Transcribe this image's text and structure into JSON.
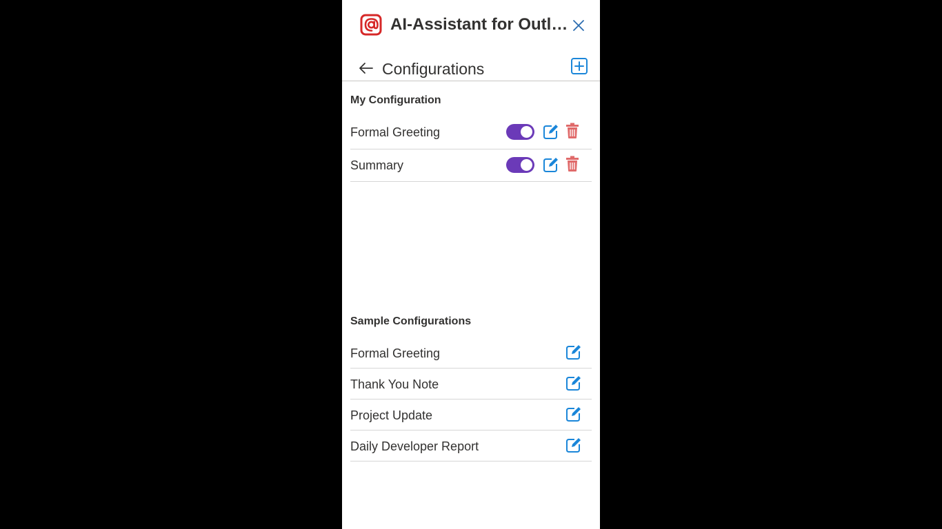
{
  "app": {
    "title": "AI-Assistant for Outlook",
    "logo_icon": "at-sign-logo-icon",
    "close_icon": "close-icon"
  },
  "nav": {
    "back_icon": "arrow-left-icon",
    "title": "Configurations",
    "add_icon": "plus-square-icon"
  },
  "my_configuration": {
    "heading": "My Configuration",
    "items": [
      {
        "label": "Formal Greeting",
        "enabled": true
      },
      {
        "label": "Summary",
        "enabled": true
      }
    ]
  },
  "sample_configurations": {
    "heading": "Sample Configurations",
    "items": [
      {
        "label": "Formal Greeting"
      },
      {
        "label": "Thank You Note"
      },
      {
        "label": "Project Update"
      },
      {
        "label": "Daily Developer Report"
      }
    ]
  },
  "colors": {
    "accent": "#6b3ab8",
    "edit_icon": "#1a86d9",
    "delete_icon": "#e06a6a",
    "logo": "#d62828",
    "background": "#000000"
  }
}
